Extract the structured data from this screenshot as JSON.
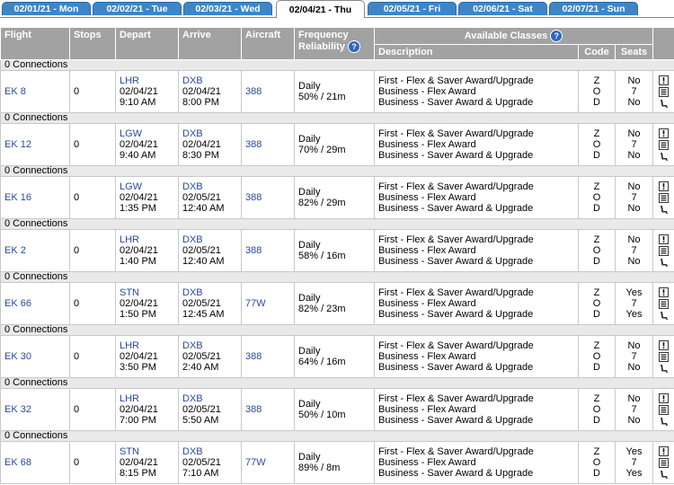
{
  "tabs": [
    {
      "label": "02/01/21 - Mon",
      "active": false
    },
    {
      "label": "02/02/21 - Tue",
      "active": false
    },
    {
      "label": "02/03/21 - Wed",
      "active": false
    },
    {
      "label": "02/04/21 - Thu",
      "active": true
    },
    {
      "label": "02/05/21 - Fri",
      "active": false
    },
    {
      "label": "02/06/21 - Sat",
      "active": false
    },
    {
      "label": "02/07/21 - Sun",
      "active": false
    }
  ],
  "headers": {
    "flight": "Flight",
    "stops": "Stops",
    "depart": "Depart",
    "arrive": "Arrive",
    "aircraft": "Aircraft",
    "frequency": "Frequency",
    "reliability": "Reliability",
    "available_classes": "Available Classes",
    "description": "Description",
    "code": "Code",
    "seats": "Seats",
    "help_icon": "?"
  },
  "colors": {
    "tab": "#3c86c8",
    "header": "#a2a2a2",
    "connection_row": "#e9e9e9",
    "link": "#2a4a9a",
    "help": "#2b66c2"
  },
  "connections_label": "0 Connections",
  "flights": [
    {
      "flight": "EK 8",
      "stops": "0",
      "dep_airport": "LHR",
      "dep_date": "02/04/21",
      "dep_time": "9:10 AM",
      "arr_airport": "DXB",
      "arr_date": "02/04/21",
      "arr_time": "8:00 PM",
      "aircraft": "388",
      "frequency": "Daily",
      "reliability": "50% / 21m",
      "classes": [
        {
          "desc": "First - Flex & Saver Award/Upgrade",
          "code": "Z",
          "seats": "No"
        },
        {
          "desc": "Business - Flex Award",
          "code": "O",
          "seats": "7"
        },
        {
          "desc": "Business - Saver Award & Upgrade",
          "code": "D",
          "seats": "No"
        }
      ]
    },
    {
      "flight": "EK 12",
      "stops": "0",
      "dep_airport": "LGW",
      "dep_date": "02/04/21",
      "dep_time": "9:40 AM",
      "arr_airport": "DXB",
      "arr_date": "02/04/21",
      "arr_time": "8:30 PM",
      "aircraft": "388",
      "frequency": "Daily",
      "reliability": "70% / 29m",
      "classes": [
        {
          "desc": "First - Flex & Saver Award/Upgrade",
          "code": "Z",
          "seats": "No"
        },
        {
          "desc": "Business - Flex Award",
          "code": "O",
          "seats": "7"
        },
        {
          "desc": "Business - Saver Award & Upgrade",
          "code": "D",
          "seats": "No"
        }
      ]
    },
    {
      "flight": "EK 16",
      "stops": "0",
      "dep_airport": "LGW",
      "dep_date": "02/04/21",
      "dep_time": "1:35 PM",
      "arr_airport": "DXB",
      "arr_date": "02/05/21",
      "arr_time": "12:40 AM",
      "aircraft": "388",
      "frequency": "Daily",
      "reliability": "82% / 29m",
      "classes": [
        {
          "desc": "First - Flex & Saver Award/Upgrade",
          "code": "Z",
          "seats": "No"
        },
        {
          "desc": "Business - Flex Award",
          "code": "O",
          "seats": "7"
        },
        {
          "desc": "Business - Saver Award & Upgrade",
          "code": "D",
          "seats": "No"
        }
      ]
    },
    {
      "flight": "EK 2",
      "stops": "0",
      "dep_airport": "LHR",
      "dep_date": "02/04/21",
      "dep_time": "1:40 PM",
      "arr_airport": "DXB",
      "arr_date": "02/05/21",
      "arr_time": "12:40 AM",
      "aircraft": "388",
      "frequency": "Daily",
      "reliability": "58% / 16m",
      "classes": [
        {
          "desc": "First - Flex & Saver Award/Upgrade",
          "code": "Z",
          "seats": "No"
        },
        {
          "desc": "Business - Flex Award",
          "code": "O",
          "seats": "7"
        },
        {
          "desc": "Business - Saver Award & Upgrade",
          "code": "D",
          "seats": "No"
        }
      ]
    },
    {
      "flight": "EK 66",
      "stops": "0",
      "dep_airport": "STN",
      "dep_date": "02/04/21",
      "dep_time": "1:50 PM",
      "arr_airport": "DXB",
      "arr_date": "02/05/21",
      "arr_time": "12:45 AM",
      "aircraft": "77W",
      "frequency": "Daily",
      "reliability": "82% / 23m",
      "classes": [
        {
          "desc": "First - Flex & Saver Award/Upgrade",
          "code": "Z",
          "seats": "Yes"
        },
        {
          "desc": "Business - Flex Award",
          "code": "O",
          "seats": "7"
        },
        {
          "desc": "Business - Saver Award & Upgrade",
          "code": "D",
          "seats": "Yes"
        }
      ]
    },
    {
      "flight": "EK 30",
      "stops": "0",
      "dep_airport": "LHR",
      "dep_date": "02/04/21",
      "dep_time": "3:50 PM",
      "arr_airport": "DXB",
      "arr_date": "02/05/21",
      "arr_time": "2:40 AM",
      "aircraft": "388",
      "frequency": "Daily",
      "reliability": "64% / 16m",
      "classes": [
        {
          "desc": "First - Flex & Saver Award/Upgrade",
          "code": "Z",
          "seats": "No"
        },
        {
          "desc": "Business - Flex Award",
          "code": "O",
          "seats": "7"
        },
        {
          "desc": "Business - Saver Award & Upgrade",
          "code": "D",
          "seats": "No"
        }
      ]
    },
    {
      "flight": "EK 32",
      "stops": "0",
      "dep_airport": "LHR",
      "dep_date": "02/04/21",
      "dep_time": "7:00 PM",
      "arr_airport": "DXB",
      "arr_date": "02/05/21",
      "arr_time": "5:50 AM",
      "aircraft": "388",
      "frequency": "Daily",
      "reliability": "50% / 10m",
      "classes": [
        {
          "desc": "First - Flex & Saver Award/Upgrade",
          "code": "Z",
          "seats": "No"
        },
        {
          "desc": "Business - Flex Award",
          "code": "O",
          "seats": "7"
        },
        {
          "desc": "Business - Saver Award & Upgrade",
          "code": "D",
          "seats": "No"
        }
      ]
    },
    {
      "flight": "EK 68",
      "stops": "0",
      "dep_airport": "STN",
      "dep_date": "02/04/21",
      "dep_time": "8:15 PM",
      "arr_airport": "DXB",
      "arr_date": "02/05/21",
      "arr_time": "7:10 AM",
      "aircraft": "77W",
      "frequency": "Daily",
      "reliability": "89% / 8m",
      "classes": [
        {
          "desc": "First - Flex & Saver Award/Upgrade",
          "code": "Z",
          "seats": "Yes"
        },
        {
          "desc": "Business - Flex Award",
          "code": "O",
          "seats": "7"
        },
        {
          "desc": "Business - Saver Award & Upgrade",
          "code": "D",
          "seats": "Yes"
        }
      ]
    }
  ]
}
